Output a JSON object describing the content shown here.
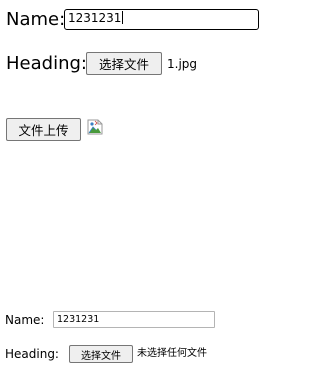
{
  "upload_form": {
    "name_label": "Name:",
    "name_value": "1231231",
    "heading_label": "Heading:",
    "file_button_label": "选择文件",
    "file_name": "1.jpg",
    "submit_label": "文件上传"
  },
  "preview": {
    "image_state": "broken-image-icon"
  },
  "second_form": {
    "name_label": "Name:",
    "name_value": "1231231",
    "heading_label": "Heading:",
    "file_button_label": "选择文件",
    "file_status": "未选择任何文件"
  }
}
